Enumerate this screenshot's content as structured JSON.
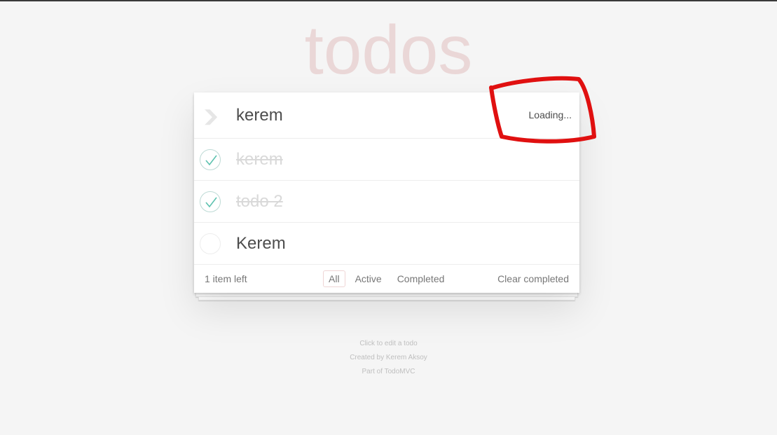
{
  "app": {
    "title": "todos"
  },
  "header": {
    "input_value": "kerem",
    "status_text": "Loading..."
  },
  "todos": [
    {
      "label": "kerem",
      "completed": true
    },
    {
      "label": "todo 2",
      "completed": true
    },
    {
      "label": "Kerem",
      "completed": false
    }
  ],
  "footer": {
    "count_text": "1 item left",
    "filters": [
      "All",
      "Active",
      "Completed"
    ],
    "selected_filter": "All",
    "clear_label": "Clear completed"
  },
  "info": {
    "line1": "Click to edit a todo",
    "line2": "Created by Kerem Aksoy",
    "line3": "Part of TodoMVC"
  },
  "colors": {
    "title": "#ead7d7",
    "check_green": "#5dc2af",
    "annotation_red": "#e01010"
  },
  "icons": {
    "toggle_all": "chevron-down-icon",
    "completed_checkbox": "checkmark-icon"
  }
}
